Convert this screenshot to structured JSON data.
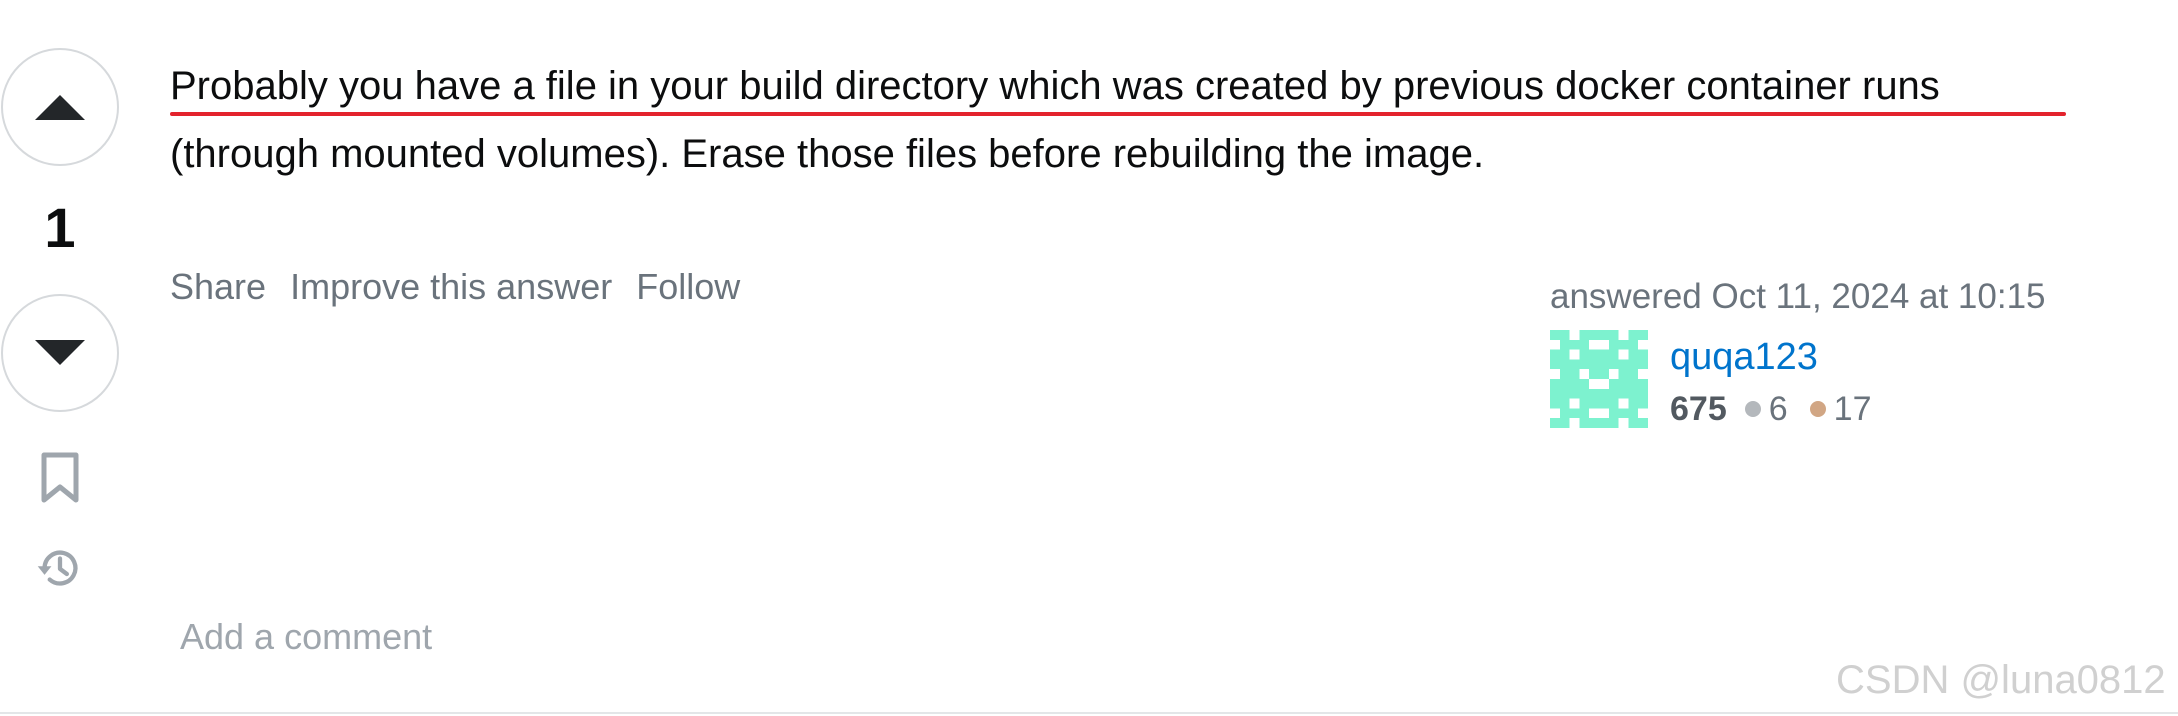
{
  "vote": {
    "count": "1",
    "up_icon": "triangle-up-icon",
    "down_icon": "triangle-down-icon"
  },
  "side_icons": {
    "bookmark": "bookmark-icon",
    "history": "history-icon"
  },
  "answer": {
    "body": "Probably you have a file in your build directory which was created by previous docker container runs (through mounted volumes). Erase those files before rebuilding the image.",
    "highlight_color": "#e3232d"
  },
  "post_menu": {
    "share": "Share",
    "improve": "Improve this answer",
    "follow": "Follow"
  },
  "user_card": {
    "action": "answered Oct 11, 2024 at 10:15",
    "name": "quqa123",
    "reputation": "675",
    "silver_badges": "6",
    "bronze_badges": "17",
    "avatar_color": "#7df2cf",
    "link_color": "#0074cc"
  },
  "comment": {
    "add_label": "Add a comment"
  },
  "watermark": "CSDN @luna0812"
}
